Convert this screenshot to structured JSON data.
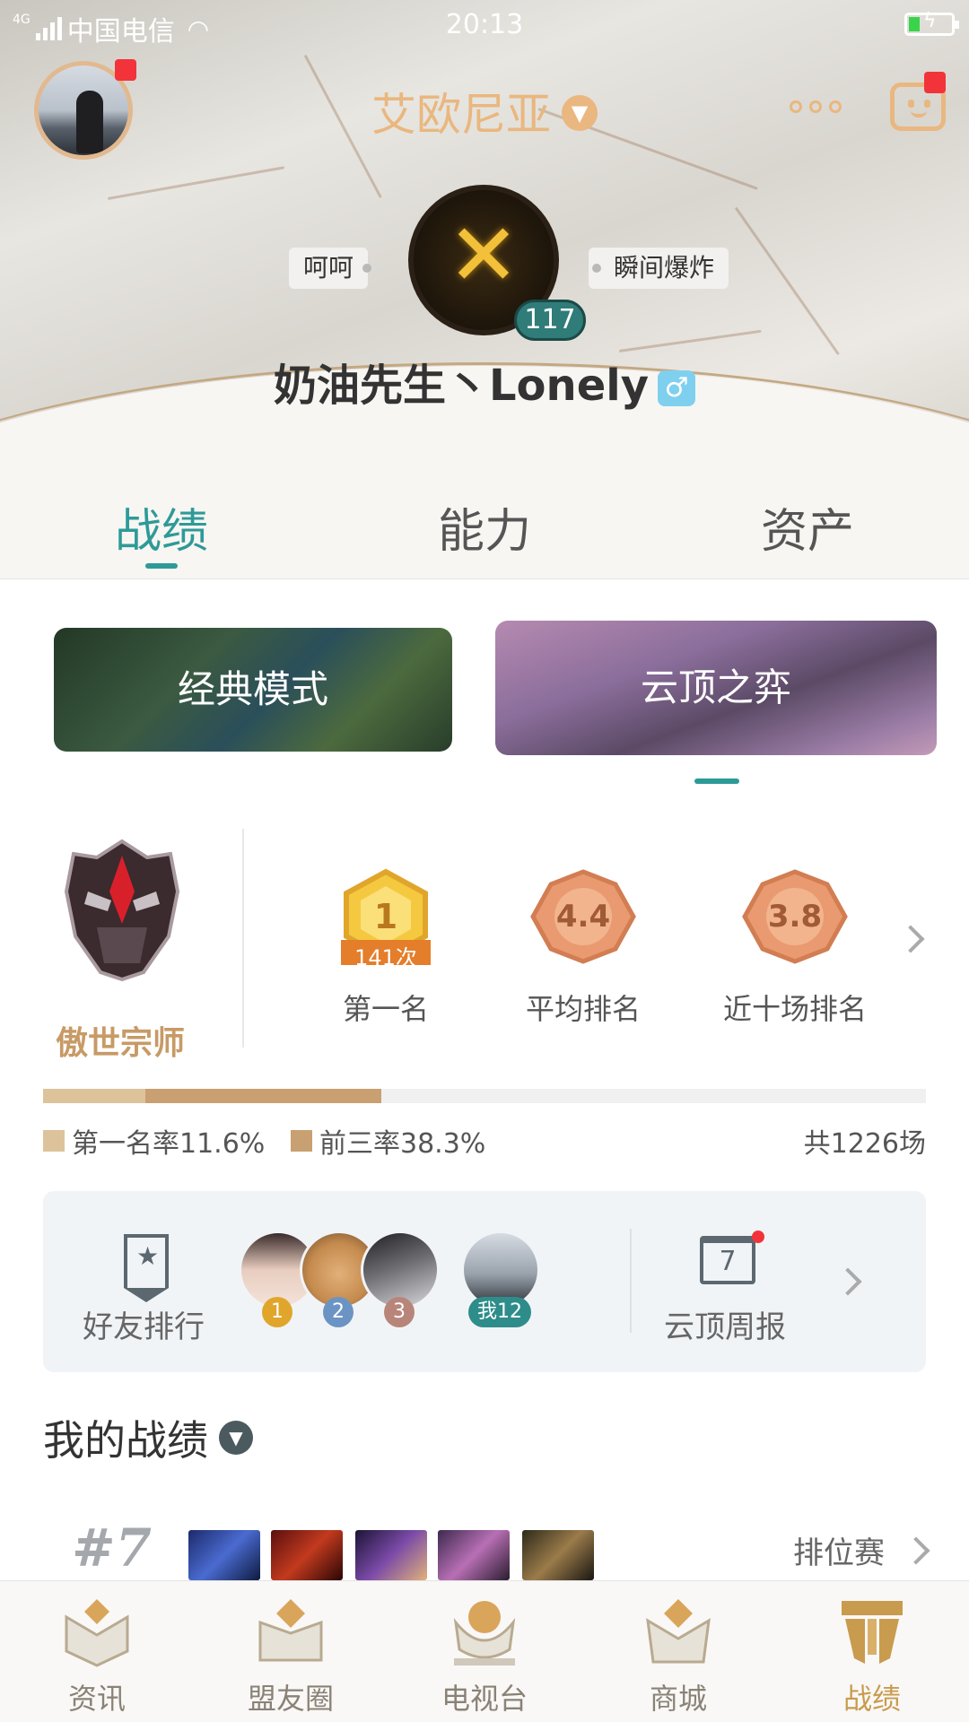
{
  "status_bar": {
    "carrier": "中国电信",
    "network": "4G",
    "time": "20:13"
  },
  "header": {
    "server": "艾欧尼亚",
    "emblem_level": "117",
    "tag_left": "呵呵",
    "tag_right": "瞬间爆炸",
    "nickname": "奶油先生丶Lonely",
    "gender_symbol": "♂"
  },
  "tabs": [
    {
      "label": "战绩",
      "active": true
    },
    {
      "label": "能力",
      "active": false
    },
    {
      "label": "资产",
      "active": false
    }
  ],
  "modes": [
    {
      "label": "经典模式",
      "active": false
    },
    {
      "label": "云顶之弈",
      "active": true
    }
  ],
  "rank": {
    "tier": "傲世宗师"
  },
  "stats": [
    {
      "value": "1",
      "badge": "141次",
      "label": "第一名"
    },
    {
      "value": "4.4",
      "label": "平均排名"
    },
    {
      "value": "3.8",
      "label": "近十场排名"
    }
  ],
  "rates": {
    "first_rate_label": "第一名率11.6%",
    "first_rate": 11.6,
    "top3_rate_label": "前三率38.3%",
    "top3_rate": 38.3,
    "total_label": "共1226场",
    "first_color": "#dcc39c",
    "top3_color": "#c9a071"
  },
  "friends": {
    "ranking_label": "好友排行",
    "badges": [
      "1",
      "2",
      "3",
      "我12"
    ],
    "badge_colors": [
      "#e0a52b",
      "#6b94c4",
      "#b8857a",
      "#2e8d8b"
    ],
    "weekly_label": "云顶周报",
    "calendar_day": "7"
  },
  "my_record": {
    "title": "我的战绩",
    "last_match": {
      "rank": "#7",
      "type": "排位赛"
    }
  },
  "bottom_nav": [
    {
      "label": "资讯",
      "icon": "news-icon",
      "active": false
    },
    {
      "label": "盟友圈",
      "icon": "friends-circle-icon",
      "active": false
    },
    {
      "label": "电视台",
      "icon": "tv-icon",
      "active": false
    },
    {
      "label": "商城",
      "icon": "shop-icon",
      "active": false
    },
    {
      "label": "战绩",
      "icon": "record-icon",
      "active": true
    }
  ],
  "colors": {
    "accent": "#2e9a98",
    "gold": "#e9b77f",
    "notification": "#f2333a"
  }
}
